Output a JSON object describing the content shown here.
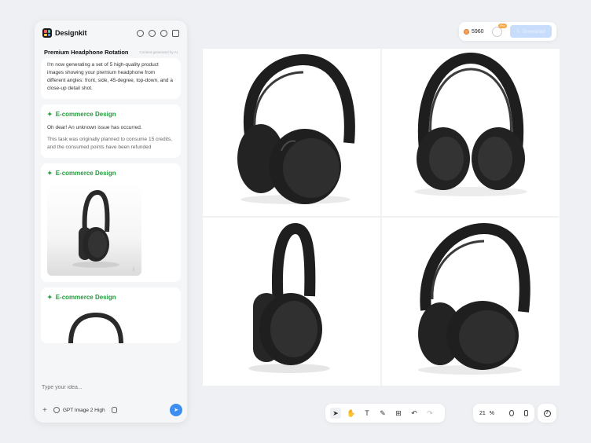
{
  "app": {
    "name": "Designkit",
    "logo_colors": [
      "#ff5b5b",
      "#4bd1a0",
      "#ffc94a",
      "#5a8cff"
    ]
  },
  "header": {
    "icons": [
      "add-chat-icon",
      "history-icon",
      "refresh-icon",
      "sidebar-toggle-icon"
    ]
  },
  "project": {
    "title": "Premium Headphone Rotation",
    "note": "Content generated by AI"
  },
  "chat": {
    "intro_message": "I'm now generating a set of 5 high-quality product images showing your premium headphone from different angles: front, side, 45-degree, top-down, and a close-up detail shot.",
    "cards": [
      {
        "title": "E-commerce Design",
        "error": "Oh dear! An unknown issue has occurred.",
        "detail": "This task was originally planned to consume 15 credits, and the consumed points have been refunded"
      },
      {
        "title": "E-commerce Design"
      },
      {
        "title": "E-commerce Design"
      }
    ]
  },
  "composer": {
    "placeholder": "Type your idea...",
    "model_label": "GPT Image 2 High"
  },
  "topbar": {
    "credits": "5960",
    "pro_badge": "Pro",
    "download_label": "Download"
  },
  "zoom": {
    "value": "21",
    "unit": "%"
  },
  "colors": {
    "accent_green": "#1f9d3a",
    "send_blue": "#3d8ef0",
    "download_disabled": "#c8ddfb"
  }
}
